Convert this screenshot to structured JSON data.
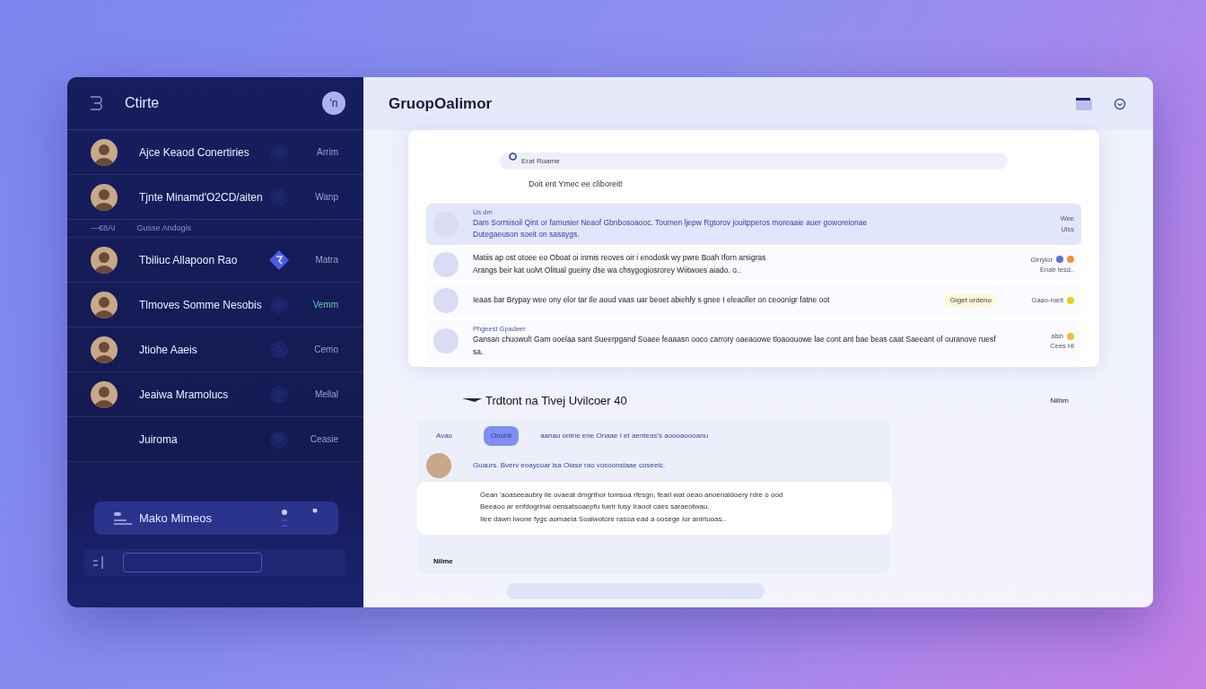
{
  "sidebar": {
    "title": "Ctirte",
    "account_initial": "'n",
    "contacts": [
      {
        "kind": "contact",
        "name": "Ajce Keaod Conertiries",
        "status": "Arrim",
        "has_avatar": true,
        "active": false,
        "online": false
      },
      {
        "kind": "contact",
        "name": "Tjnte Minamd'O2CD/aiten",
        "status": "Wanp",
        "has_avatar": true,
        "active": false,
        "online": false
      },
      {
        "kind": "section",
        "prefix": "—€8AI",
        "name": "Gusse Andogis"
      },
      {
        "kind": "contact",
        "name": "Tbiliuc Allapoon Rao",
        "status": "Matra",
        "has_avatar": true,
        "active": true,
        "online": false
      },
      {
        "kind": "contact",
        "name": "Tlmoves Somme Nesobis",
        "status": "Vemm",
        "has_avatar": true,
        "active": false,
        "online": true
      },
      {
        "kind": "contact",
        "name": "Jtiohe Aaeis",
        "status": "Cemo",
        "has_avatar": true,
        "active": false,
        "online": false
      },
      {
        "kind": "contact",
        "name": "Jeaiwa Mramolucs",
        "status": "Mellal",
        "has_avatar": true,
        "active": false,
        "online": false
      },
      {
        "kind": "contact",
        "name": "Juiroma",
        "status": "Ceasie",
        "has_avatar": false,
        "active": false,
        "online": false
      }
    ],
    "user": {
      "name": "Mako Mimeos"
    }
  },
  "main": {
    "title": "GruopOalimor",
    "search": {
      "placeholder": "Erat Roame"
    },
    "notice": "Doit ent Ymec ee cliboreit!",
    "messages": [
      {
        "author": "Us dm",
        "highlighted": true,
        "lines": [
          "Dam Sorrsisoil Qint or famusier Neaof Gbnbosoaooc. Toumen ljepw Rgtorov jouitpperos moreaaie auer goworeionae",
          "Dutegaeuson soeit on sasaygs."
        ],
        "meta": [
          "Wee",
          "Uiss"
        ]
      },
      {
        "highlighted": false,
        "lines": [
          "Matiis ap ost otoee eo Oboat oi inrnis reoves oir i enodosk wy pwre Boah Iforn arsigras",
          "Arangs beir kat uolvt Olitual gueiny dse wa chsygogiosrorey Wiitwoes aiado. o.."
        ],
        "meta": [
          "Glrrylor",
          "Enab tesd.."
        ],
        "dots": [
          {
            "color": "#5b6ee0"
          },
          {
            "color": "#e8953a"
          }
        ]
      },
      {
        "highlighted": false,
        "lines": [
          "Ieaas bar Brypay wee ony elor tar Ile aoud vaas uar beoet abiehfy s gnee I eleaoller on ceoonigr fatne oot"
        ],
        "tag": "Giget ordeno",
        "meta": [
          "Gaao-roeit"
        ],
        "dots": [
          {
            "color": "#e6d020"
          }
        ]
      },
      {
        "author": "Phgeest Gpadeer",
        "highlighted": false,
        "lines": [
          "Gansan chuowul! Gam ooelaa sant Sueerpgand Soaee feaaasn ooco carrory oaeaoowe tloaoouowe lae cont ant bae beas caat Saeeant of ouranove ruesf sa."
        ],
        "meta": [
          "alsh",
          "Cees Hl"
        ],
        "dots": [
          {
            "color": "#f0c030"
          }
        ]
      }
    ],
    "thread": {
      "title": "Trdtont na Tivej Uvilcoer 40",
      "side_label": "Nilhm",
      "author": "Avao",
      "chip": "Onoidi",
      "chip_text": "aanau ontne ene Onaae I et aenteas's aoooaoooanu",
      "intro": "Guaurs. Bverv eoaycoar isa Oiase rao vosoonsiaae coseeic.",
      "body": [
        "Gean 'aoaseeaubry ile ovaeat dmgrthor tomsoa rfesgn, fearl wat oeao anoenaldoery rdre o ood",
        "Beeaoo ar enfdogrinal oensatsoaepfu tueir tusy Iraoot caes saraeotwau.",
        "Ilee dawn Iwone fygc aomaeia Soalwotore rasoa ead a oosege Ior anirtuoas.."
      ],
      "footer": "Nilme"
    }
  }
}
